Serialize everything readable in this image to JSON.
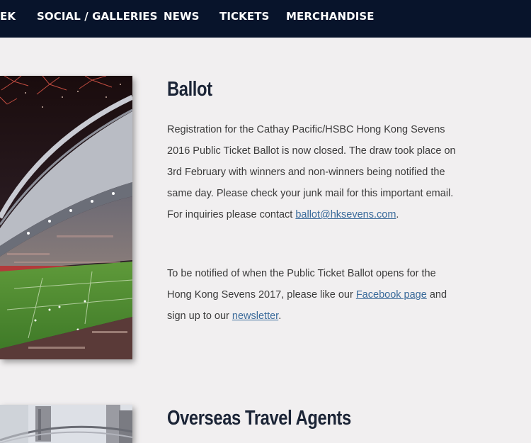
{
  "nav": {
    "items": [
      {
        "label": "EK"
      },
      {
        "label": "SOCIAL / GALLERIES"
      },
      {
        "label": "NEWS"
      },
      {
        "label": "TICKETS"
      },
      {
        "label": "MERCHANDISE"
      }
    ]
  },
  "ballot": {
    "title": "Ballot",
    "para1_text": "Registration for the Cathay Pacific/HSBC Hong Kong Sevens 2016 Public Ticket Ballot is now closed. The draw took place on 3rd February with winners and non-winners being notified the same day. Please check your junk mail for this important email. For inquiries please contact ",
    "email_link": "ballot@hksevens.com",
    "para1_end": ".",
    "para2_text": "To be notified of when the Public Ticket Ballot opens for the Hong Kong Sevens 2017, please like our ",
    "facebook_link": "Facebook page",
    "para2_mid": " and sign up to our ",
    "newsletter_link": "newsletter",
    "para2_end": "."
  },
  "overseas": {
    "title": "Overseas Travel Agents"
  },
  "colors": {
    "nav_background": "#08142b",
    "page_background": "#f1eff0",
    "heading": "#1b2436",
    "link": "#3a6a9a"
  }
}
